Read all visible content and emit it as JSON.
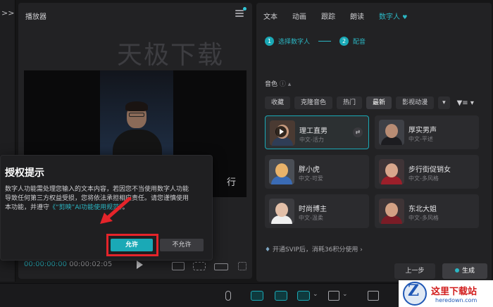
{
  "left_strip": {
    "chevron": ">>"
  },
  "player": {
    "title": "播放器",
    "watermark": "天极下载",
    "side_text": "行",
    "current_time": "00:00:00:00",
    "duration": "00:00:02:05"
  },
  "dialog": {
    "title": "授权提示",
    "body_line1": "数字人功能需处理您输入的文本内容，若因您不当使用数字人功能",
    "body_line2": "导致任何第三方权益受损，您将依法承担相应责任。请您谨慎使用",
    "body_line3_prefix": "本功能，并遵守",
    "body_link": "《“剪映”AI功能使用规范》",
    "body_line3_suffix": "。",
    "allow_label": "允许",
    "deny_label": "不允许"
  },
  "right_panel": {
    "tabs": [
      {
        "label": "文本"
      },
      {
        "label": "动画"
      },
      {
        "label": "跟踪"
      },
      {
        "label": "朗读"
      },
      {
        "label": "数字人"
      }
    ],
    "heart": "♥",
    "steps": [
      {
        "num": "1",
        "label": "选择数字人"
      },
      {
        "num": "2",
        "label": "配音"
      }
    ],
    "section_label": "音色",
    "section_help": "ⓘ ▴",
    "chips": [
      "收藏",
      "克隆音色",
      "热门",
      "最新",
      "影视动漫"
    ],
    "chip_drop": "▾",
    "filter": "▼≡ ▾",
    "cards": [
      {
        "name": "理工直男",
        "sub": "中文-活力",
        "skin": "#c79a7e",
        "cloth": "#2f3d56",
        "bg": "#4a3a32"
      },
      {
        "name": "厚实男声",
        "sub": "中文-平述",
        "skin": "#b88c74",
        "cloth": "#1c1c20",
        "bg": "#3e4046"
      },
      {
        "name": "胖小虎",
        "sub": "中文-可爱",
        "skin": "#e9b36a",
        "cloth": "#3a6bb5",
        "bg": "#4a4e55"
      },
      {
        "name": "步行街促销女",
        "sub": "中文-多风格",
        "skin": "#d8a68c",
        "cloth": "#9b1f2a",
        "bg": "#3f3437"
      },
      {
        "name": "时尚博主",
        "sub": "中文-温柔",
        "skin": "#e2bfa8",
        "cloth": "#efefef",
        "bg": "#3c3c40"
      },
      {
        "name": "东北大姐",
        "sub": "中文-多风格",
        "skin": "#d3a184",
        "cloth": "#7a1c26",
        "bg": "#3e3436"
      }
    ],
    "swap_icon": "⇄",
    "svip_text": "开通SVIP后，消耗36积分使用 ›",
    "prev_label": "上一步",
    "gen_label": "生成"
  },
  "site_logo": {
    "letter": "Z",
    "title": "这里下载站",
    "sub": "heredown.com"
  },
  "colors": {
    "accent": "#1aa9b6",
    "highlight": "#e4242a",
    "background": "#161617"
  }
}
